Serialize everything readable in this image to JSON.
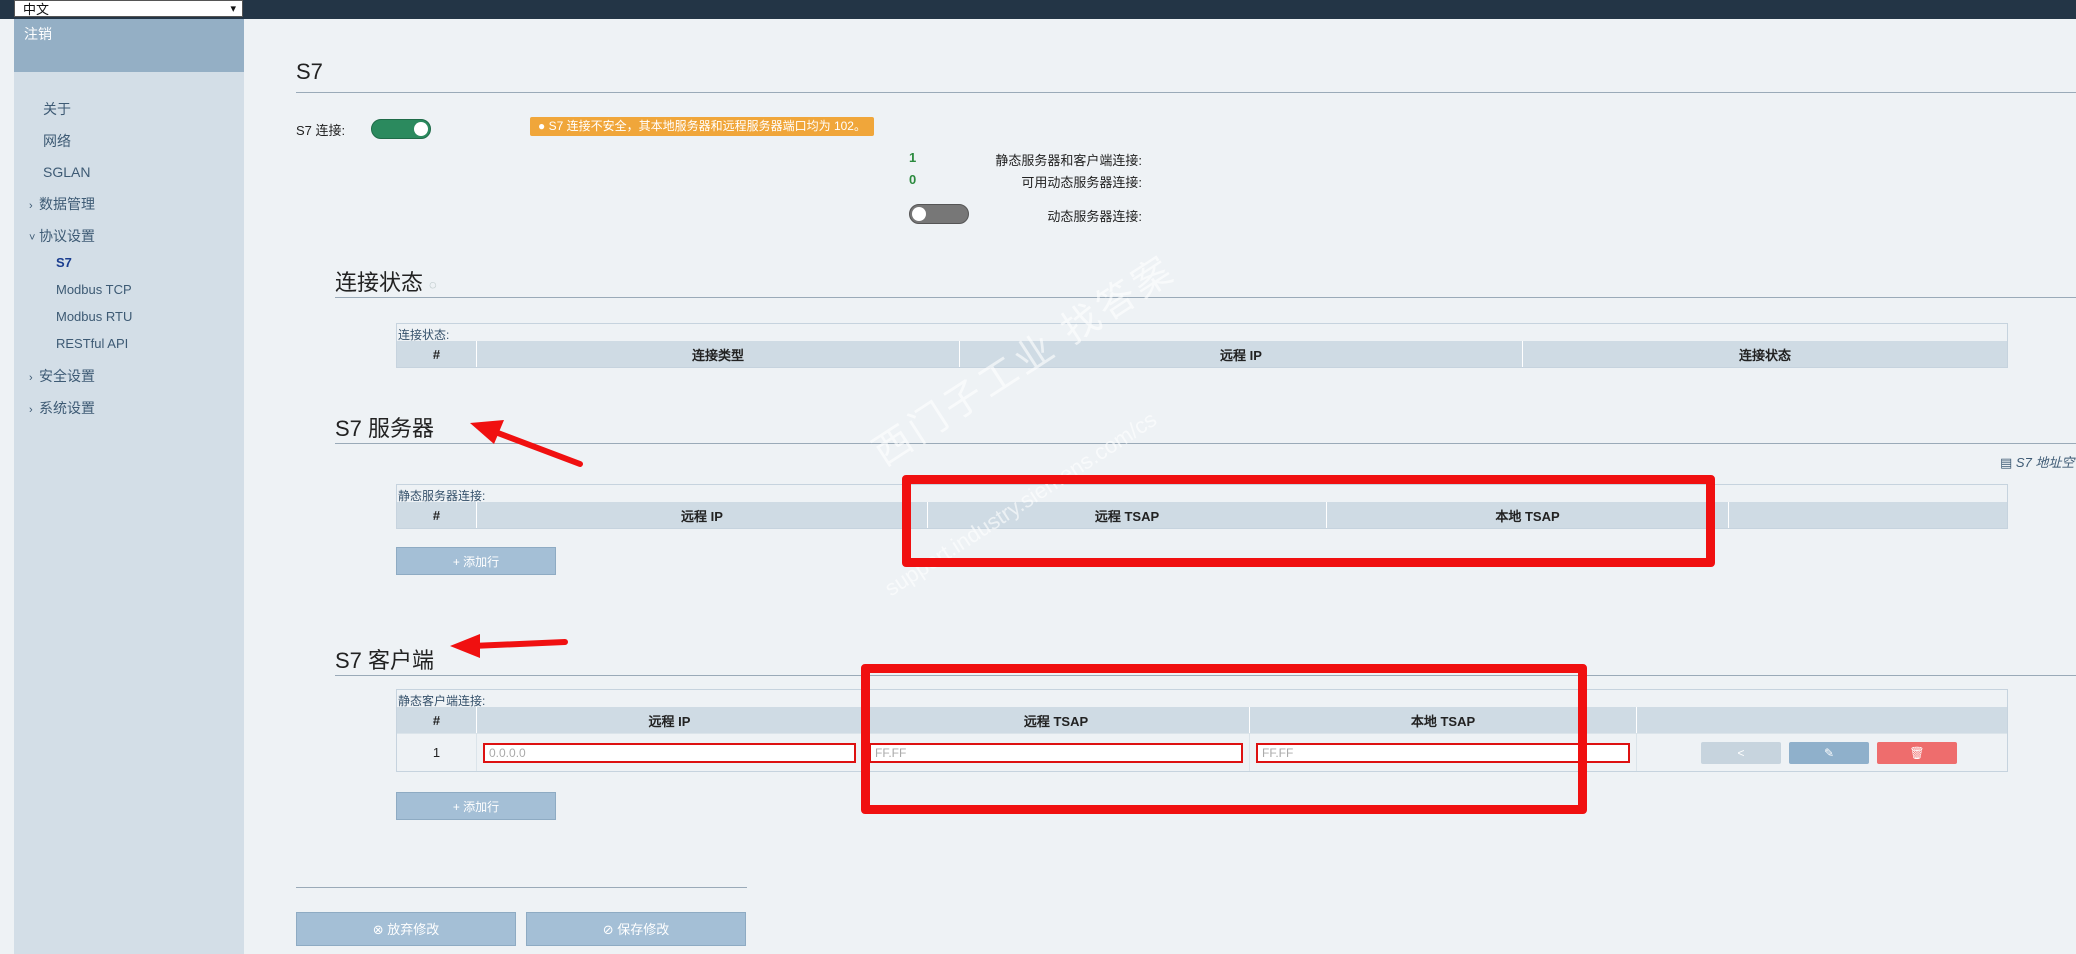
{
  "language_select": {
    "value": "中文"
  },
  "sidebar": {
    "logout": "注销",
    "items": [
      {
        "label": "关于"
      },
      {
        "label": "网络"
      },
      {
        "label": "SGLAN"
      },
      {
        "label": "数据管理",
        "caret": "›"
      },
      {
        "label": "协议设置",
        "caret": "˅"
      },
      {
        "label": "安全设置",
        "caret": "›"
      },
      {
        "label": "系统设置",
        "caret": "›"
      }
    ],
    "protocol_sub": [
      {
        "label": "S7"
      },
      {
        "label": "Modbus TCP"
      },
      {
        "label": "Modbus RTU"
      },
      {
        "label": "RESTful API"
      }
    ]
  },
  "page": {
    "title": "S7",
    "s7_connection_label": "S7 连接:",
    "warning": "S7 连接不安全，其本地服务器和远程服务器端口均为 102。",
    "static_conn_label": "静态服务器和客户端连接:",
    "static_conn_value": "1",
    "dynamic_avail_label": "可用动态服务器连接:",
    "dynamic_avail_value": "0",
    "dynamic_conn_label": "动态服务器连接:"
  },
  "status_section": {
    "title": "连接状态",
    "caption": "连接状态:",
    "columns": [
      "#",
      "连接类型",
      "远程 IP",
      "连接状态"
    ]
  },
  "server_section": {
    "title": "S7 服务器",
    "caption": "静态服务器连接:",
    "columns": [
      "#",
      "远程 IP",
      "远程 TSAP",
      "本地 TSAP",
      ""
    ],
    "add_row": "+ 添加行",
    "address_space": "S7 地址空"
  },
  "client_section": {
    "title": "S7 客户端",
    "caption": "静态客户端连接:",
    "columns": [
      "#",
      "远程 IP",
      "远程 TSAP",
      "本地 TSAP",
      ""
    ],
    "rows": [
      {
        "index": "1",
        "remote_ip_placeholder": "0.0.0.0",
        "remote_tsap_placeholder": "FF.FF",
        "local_tsap_placeholder": "FF.FF"
      }
    ],
    "add_row": "+ 添加行"
  },
  "footer": {
    "discard": "放弃修改",
    "save": "保存修改"
  },
  "watermark": {
    "line1": "西门子工业  找答案",
    "line2": "support.industry.siemens.com/cs"
  },
  "colors": {
    "topbar": "#233546",
    "sidebar": "#d3dee7",
    "toggle_on": "#2b8a5e",
    "warning": "#f0a63a",
    "annotation_red": "#f01010"
  }
}
